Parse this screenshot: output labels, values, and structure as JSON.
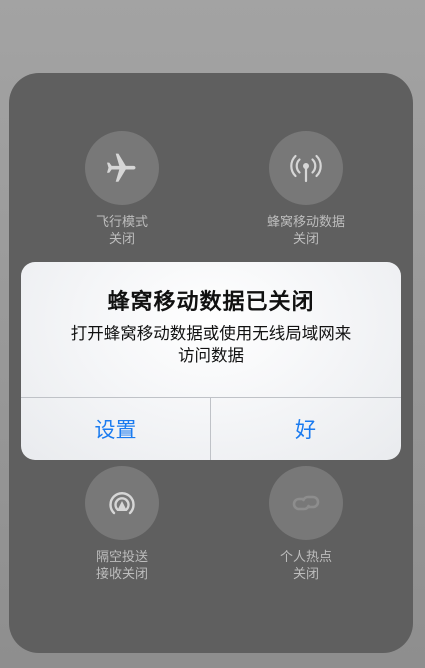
{
  "control_center": {
    "airplane": {
      "label": "飞行模式",
      "status": "关闭",
      "icon": "airplane-icon"
    },
    "cellular": {
      "label": "蜂窝移动数据",
      "status": "关闭",
      "icon": "cellular-antenna-icon"
    },
    "airdrop": {
      "label": "隔空投送",
      "status": "接收关闭",
      "icon": "airdrop-icon"
    },
    "hotspot": {
      "label": "个人热点",
      "status": "关闭",
      "icon": "hotspot-link-icon"
    }
  },
  "alert": {
    "title": "蜂窝移动数据已关闭",
    "message_line1": "打开蜂窝移动数据或使用无线局域网来",
    "message_line2": "访问数据",
    "left_button": "设置",
    "right_button": "好"
  },
  "colors": {
    "button_blue": "#1a7bf0",
    "panel": "#5f5f5f",
    "toggle_circle": "#787878"
  }
}
